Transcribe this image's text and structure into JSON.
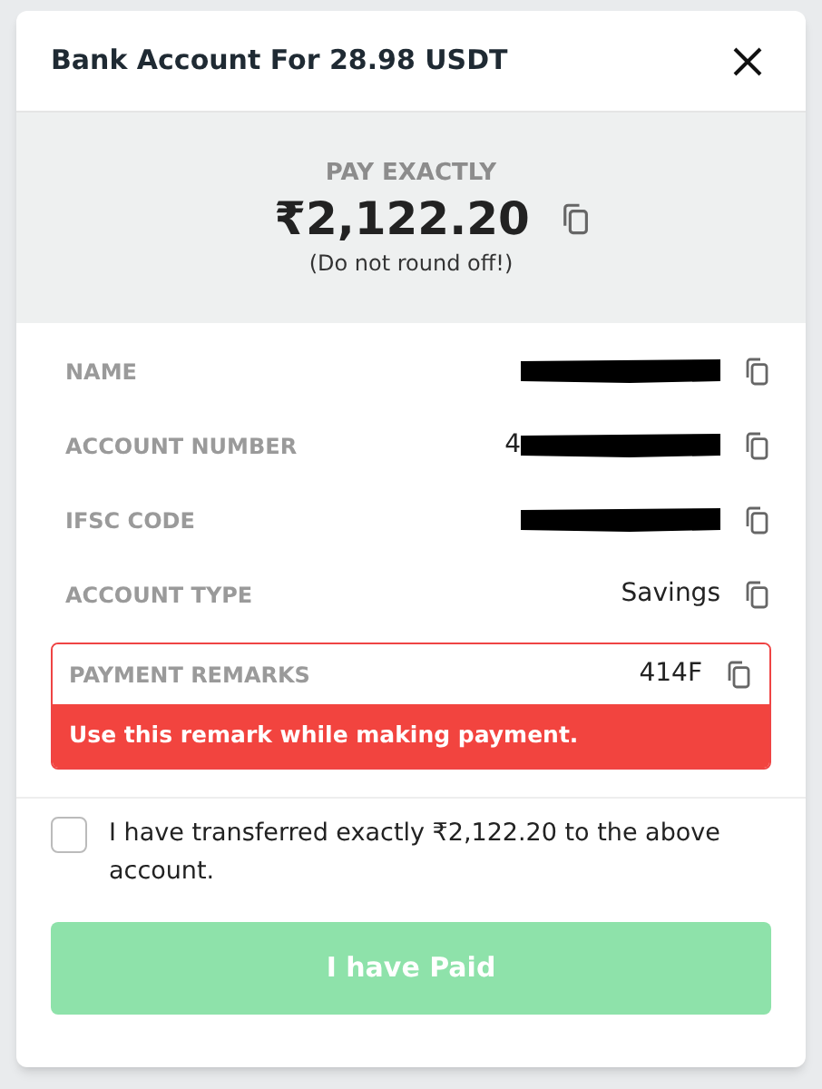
{
  "dialog": {
    "title": "Bank Account For 28.98 USDT"
  },
  "amount": {
    "label": "PAY EXACTLY",
    "value": "₹2,122.20",
    "note": "(Do not round off!)"
  },
  "fields": [
    {
      "label": "NAME",
      "redacted": true
    },
    {
      "label": "ACCOUNT NUMBER",
      "value": "4",
      "redacted": true
    },
    {
      "label": "IFSC CODE",
      "redacted": true
    },
    {
      "label": "ACCOUNT TYPE",
      "value": "Savings",
      "redacted": false
    }
  ],
  "remarks": {
    "label": "PAYMENT REMARKS",
    "value": "414F",
    "warning": "Use this remark while making payment."
  },
  "confirm": {
    "label": "I have transferred exactly ₹2,122.20 to the above account.",
    "checked": false
  },
  "submit": {
    "label": "I have Paid",
    "disabled": true
  }
}
